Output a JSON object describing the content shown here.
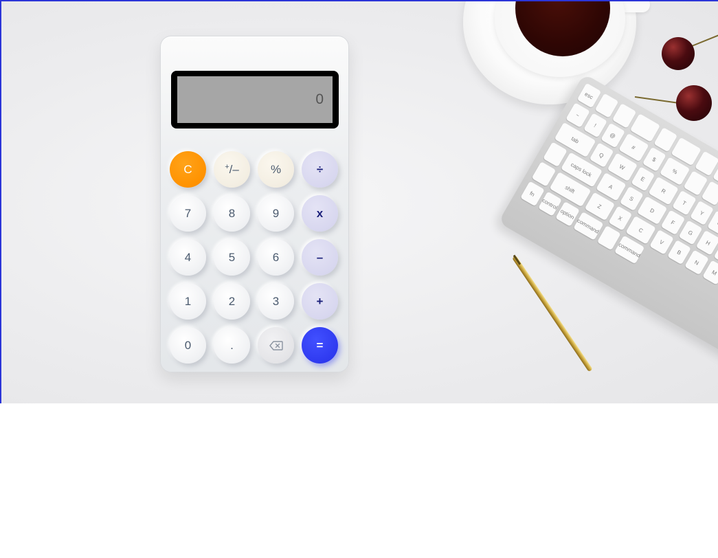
{
  "calculator": {
    "display_value": "0",
    "keys": {
      "clear": "C",
      "sign_plus": "+",
      "sign_rest": "/–",
      "percent": "%",
      "divide": "÷",
      "seven": "7",
      "eight": "8",
      "nine": "9",
      "multiply": "x",
      "four": "4",
      "five": "5",
      "six": "6",
      "subtract": "–",
      "one": "1",
      "two": "2",
      "three": "3",
      "add": "+",
      "zero": "0",
      "decimal": ".",
      "equals": "="
    },
    "icons": {
      "backspace": "backspace-icon"
    },
    "colors": {
      "clear": "#ff9200",
      "equals": "#2f3af0",
      "operator": "#d8d7ef",
      "operator_text": "#1a1f7a",
      "display_bg": "#a6a6a6",
      "frame_border": "#2b35d8"
    }
  },
  "keyboard": {
    "keys": [
      "esc",
      "",
      "",
      "",
      "",
      "",
      "",
      "",
      "",
      "",
      "",
      "",
      "",
      "~",
      "!",
      "@",
      "#",
      "$",
      "%",
      "",
      "",
      "",
      "",
      "",
      "",
      "",
      "tab",
      "Q",
      "W",
      "E",
      "R",
      "T",
      "Y",
      "U",
      "",
      "",
      "",
      "",
      "",
      "caps lock",
      "A",
      "S",
      "D",
      "F",
      "G",
      "H",
      "J",
      "",
      "",
      "",
      "",
      "shift",
      "Z",
      "X",
      "C",
      "V",
      "B",
      "N",
      "M",
      "",
      "",
      "",
      "fn",
      "control",
      "option",
      "command",
      "",
      "command"
    ]
  }
}
